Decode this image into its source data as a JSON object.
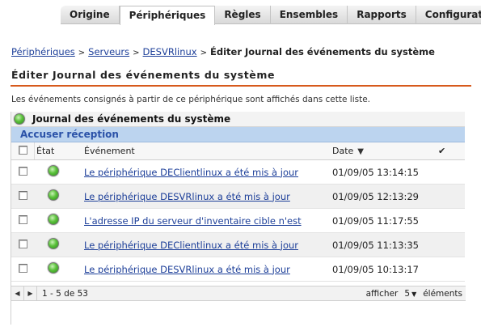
{
  "nav": {
    "tabs": [
      {
        "label": "Origine"
      },
      {
        "label": "Périphériques"
      },
      {
        "label": "Règles"
      },
      {
        "label": "Ensembles"
      },
      {
        "label": "Rapports"
      },
      {
        "label": "Configuration"
      }
    ],
    "active": "Périphériques"
  },
  "breadcrumb": {
    "items": [
      "Périphériques",
      "Serveurs",
      "DESVRlinux"
    ],
    "current": "Éditer Journal des événements du système",
    "separator": ">"
  },
  "page": {
    "title": "Éditer Journal des événements du système",
    "description": "Les événements consignés à partir de ce périphérique sont affichés dans cette liste."
  },
  "panel": {
    "title": "Journal des événements du système",
    "ack_button": "Accuser réception",
    "columns": {
      "state": "État",
      "event": "Événement",
      "date": "Date",
      "sort_icon": "sort-descending-icon",
      "ack_icon": "checkmark-icon"
    },
    "rows": [
      {
        "event": "Le périphérique DEClientlinux a été mis à jour",
        "date": "01/09/05 13:14:15"
      },
      {
        "event": "Le périphérique DESVRlinux a été mis à jour",
        "date": "01/09/05 12:13:29"
      },
      {
        "event": "L'adresse IP du serveur d'inventaire cible n'est",
        "date": "01/09/05 11:17:55"
      },
      {
        "event": "Le périphérique DEClientlinux a été mis à jour",
        "date": "01/09/05 11:13:35"
      },
      {
        "event": "Le périphérique DESVRlinux a été mis à jour",
        "date": "01/09/05 10:13:17"
      }
    ],
    "pager": {
      "range": "1 - 5 de 53",
      "show_label": "afficher",
      "page_size": "5",
      "items_label": "éléments"
    }
  },
  "colors": {
    "accent": "#d75a1c",
    "link": "#1d3f99",
    "ack_bar": "#bcd4ef",
    "status_ok": "#5ac13a"
  }
}
